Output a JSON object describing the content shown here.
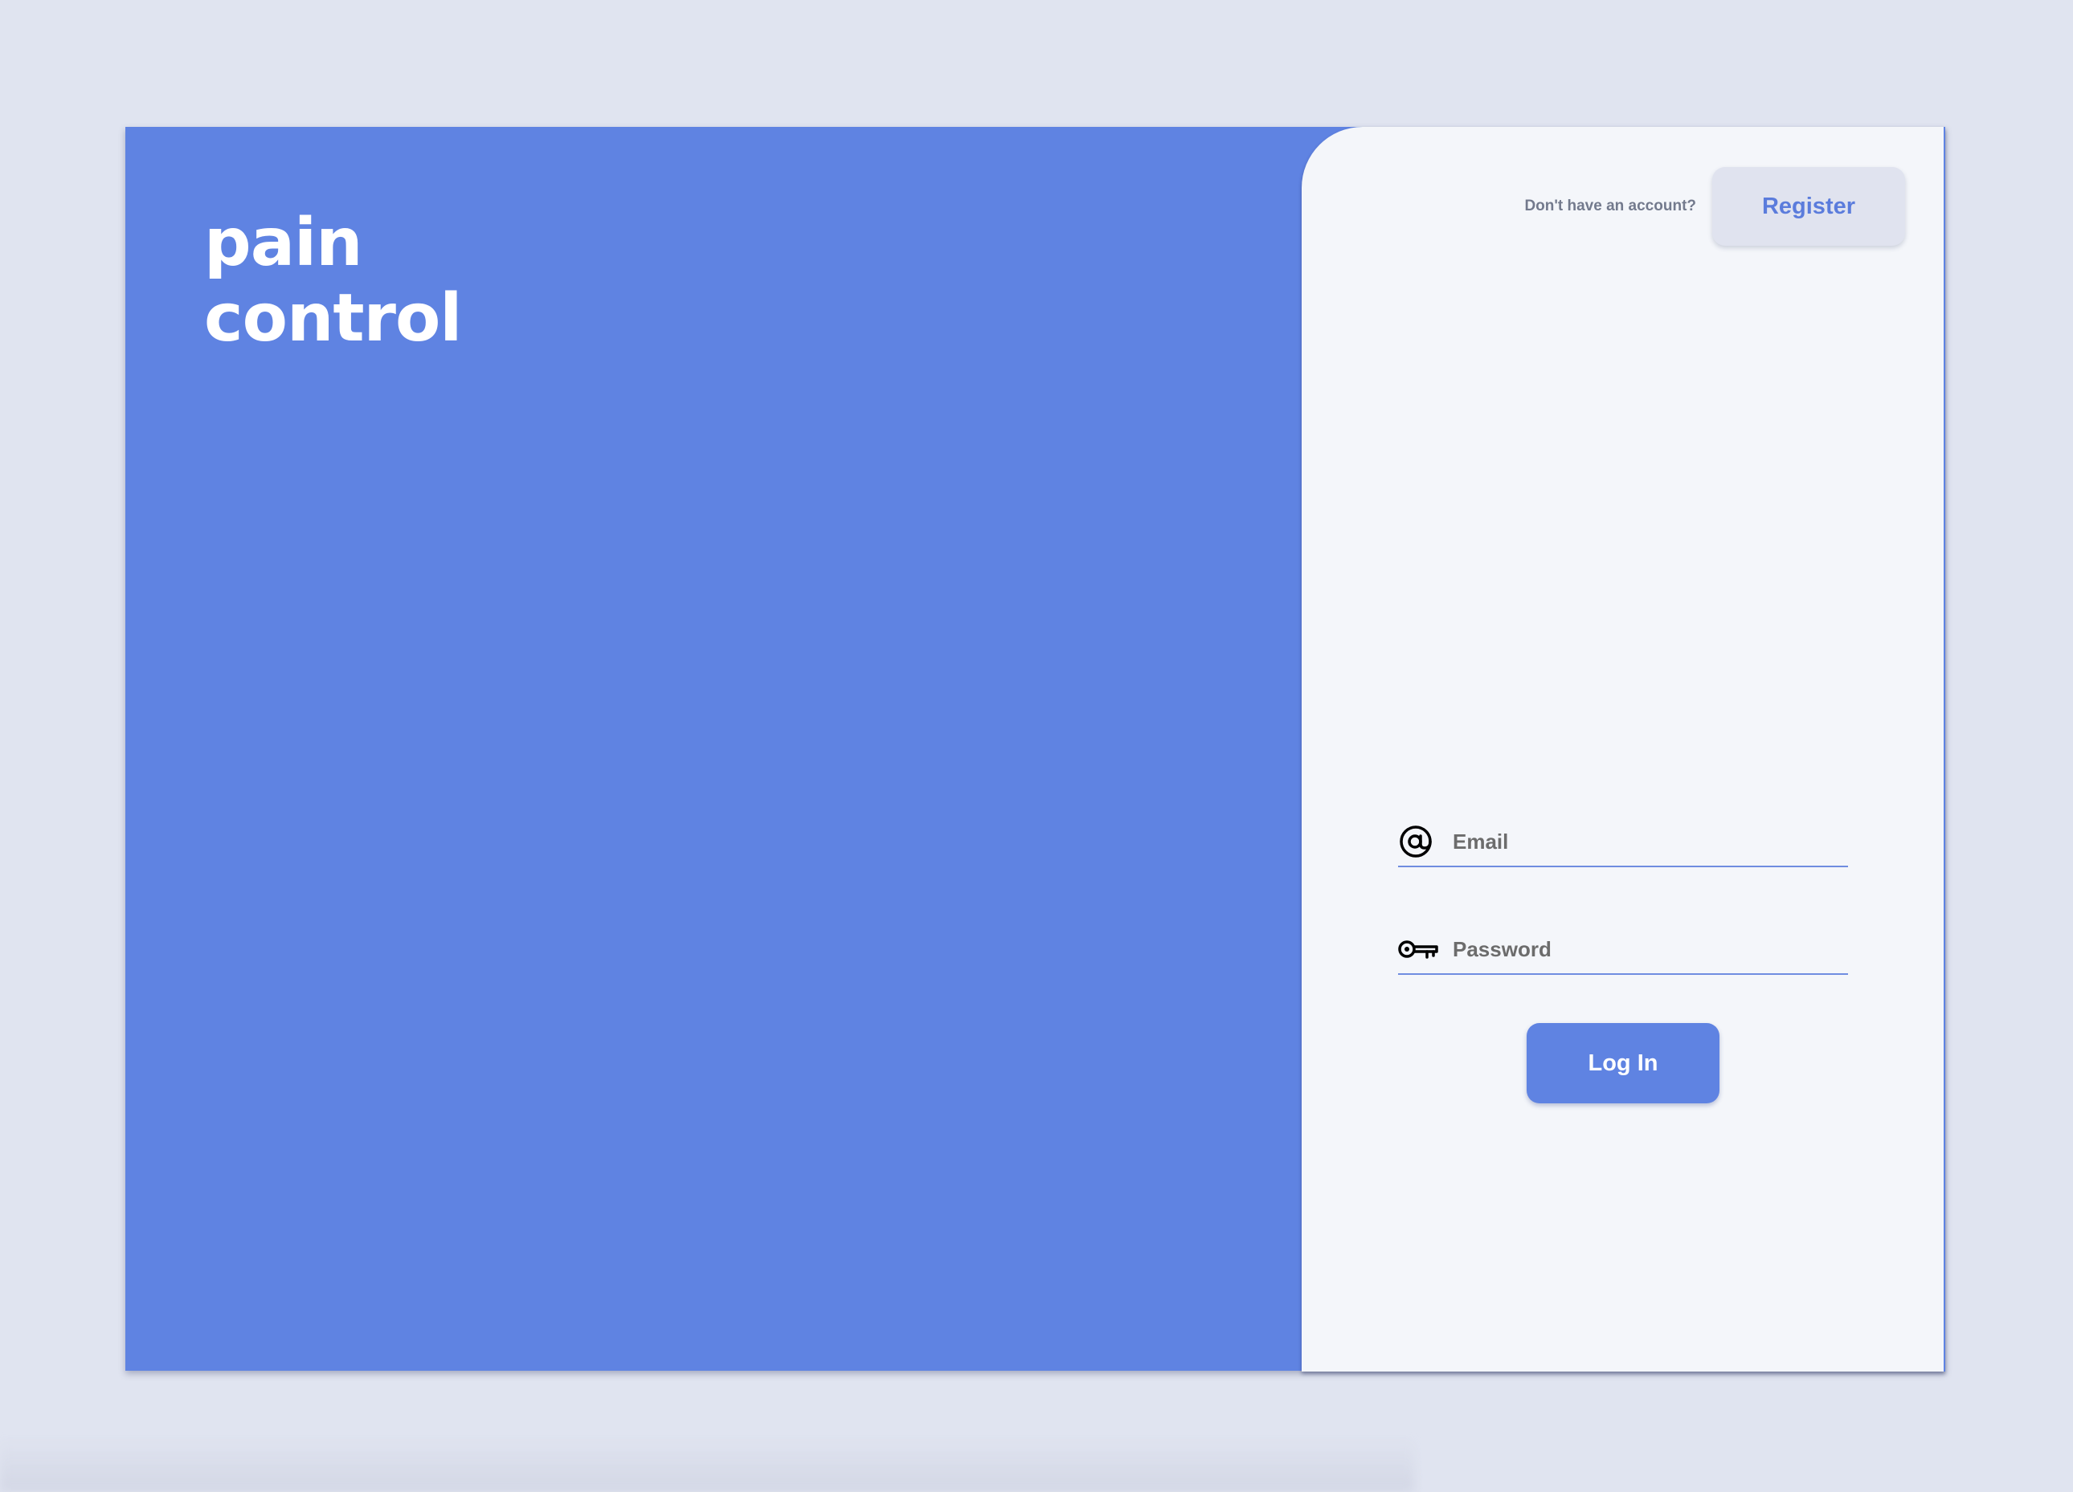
{
  "brand": {
    "line1": "pain",
    "line2": "control"
  },
  "header": {
    "account_prompt": "Don't have an account?",
    "register_label": "Register"
  },
  "form": {
    "email": {
      "placeholder": "Email",
      "value": ""
    },
    "password": {
      "placeholder": "Password",
      "value": ""
    },
    "login_label": "Log In"
  },
  "icons": {
    "email": "at-sign-icon",
    "password": "key-icon"
  },
  "colors": {
    "accent": "#5f83e2",
    "panel_background": "#f4f6fa",
    "page_background": "#e0e4f0",
    "register_background": "#e0e3ef"
  }
}
